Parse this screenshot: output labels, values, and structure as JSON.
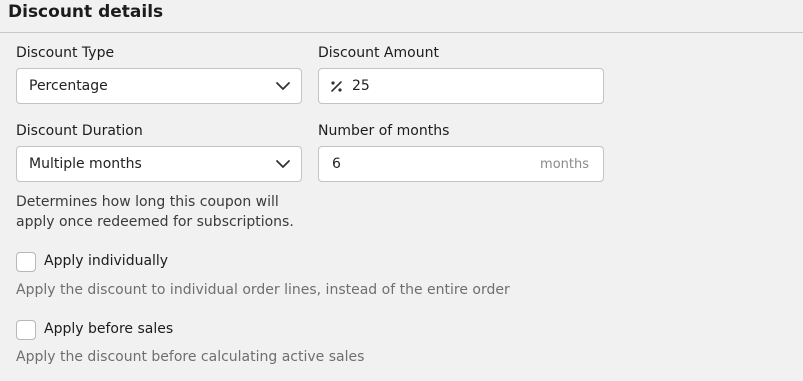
{
  "section": {
    "title": "Discount details"
  },
  "discount_type": {
    "label": "Discount Type",
    "value": "Percentage"
  },
  "discount_amount": {
    "label": "Discount Amount",
    "icon": "percent-icon",
    "value": "25"
  },
  "discount_duration": {
    "label": "Discount Duration",
    "value": "Multiple months",
    "help_line1": "Determines how long this coupon will",
    "help_line2": "apply once redeemed for subscriptions."
  },
  "number_of_months": {
    "label": "Number of months",
    "value": "6",
    "suffix": "months"
  },
  "apply_individually": {
    "label": "Apply individually",
    "checked": false,
    "help": "Apply the discount to individual order lines, instead of the entire order"
  },
  "apply_before_sales": {
    "label": "Apply before sales",
    "checked": false,
    "help": "Apply the discount before calculating active sales"
  }
}
